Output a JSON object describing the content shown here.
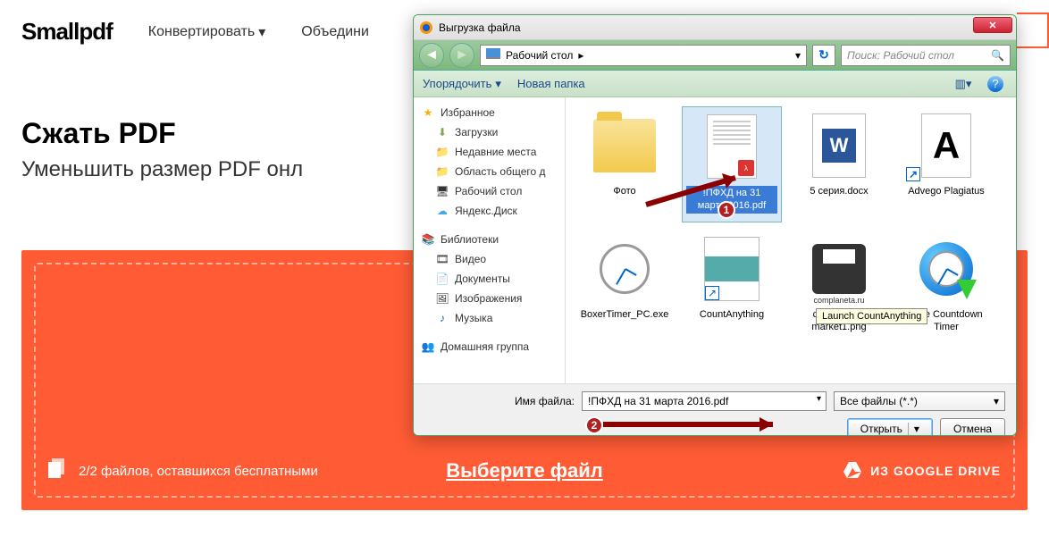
{
  "header": {
    "logo": "Smallpdf",
    "nav": [
      "Конвертировать",
      "Объедини"
    ]
  },
  "page": {
    "title": "Сжать PDF",
    "subtitle": "Уменьшить размер PDF онл"
  },
  "dropzone": {
    "files_left": "2/2 файлов, оставшихся бесплатными",
    "choose": "Выберите файл",
    "gdrive": "ИЗ GOOGLE DRIVE"
  },
  "dialog": {
    "title": "Выгрузка файла",
    "breadcrumb": "Рабочий стол",
    "search_placeholder": "Поиск: Рабочий стол",
    "toolbar": {
      "organize": "Упорядочить",
      "new_folder": "Новая папка"
    },
    "sidebar": {
      "fav": {
        "head": "Избранное",
        "items": [
          "Загрузки",
          "Недавние места",
          "Область общего д",
          "Рабочий стол",
          "Яндекс.Диск"
        ]
      },
      "lib": {
        "head": "Библиотеки",
        "items": [
          "Видео",
          "Документы",
          "Изображения",
          "Музыка"
        ]
      },
      "home": {
        "head": "Домашняя группа"
      }
    },
    "files": [
      {
        "name": "Фото",
        "type": "folder"
      },
      {
        "name": "!ПФХД на 31 марта 2016.pdf",
        "type": "pdf",
        "selected": true
      },
      {
        "name": "5 серия.docx",
        "type": "word"
      },
      {
        "name": "Advego Plagiatus",
        "type": "a"
      },
      {
        "name": "BoxerTimer_PC.exe",
        "type": "clock"
      },
      {
        "name": "CountAnything",
        "type": "screenshot"
      },
      {
        "name": "cropped-pc-market1.png",
        "type": "printer"
      },
      {
        "name": "Free Countdown Timer",
        "type": "countdown"
      }
    ],
    "tooltip": "Launch CountAnything",
    "filename_label": "Имя файла:",
    "filename_value": "!ПФХД на 31 марта 2016.pdf",
    "filter": "Все файлы (*.*)",
    "open": "Открыть",
    "cancel": "Отмена"
  },
  "badges": {
    "one": "1",
    "two": "2"
  },
  "complaneta": "complaneta.ru"
}
